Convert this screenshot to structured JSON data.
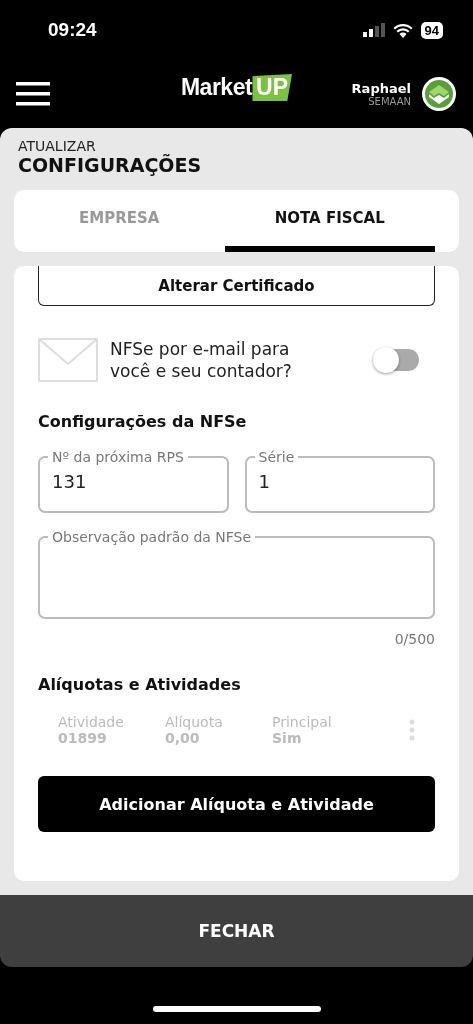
{
  "status_bar": {
    "time": "09:24",
    "battery": "94"
  },
  "header": {
    "logo": {
      "text": "Market",
      "badge": "UP"
    },
    "user": {
      "first_name": "Raphael",
      "last_name": "SEMAAN"
    }
  },
  "page": {
    "subtitle": "ATUALIZAR",
    "title": "CONFIGURAÇÕES"
  },
  "tabs": [
    {
      "label": "EMPRESA",
      "selected": false
    },
    {
      "label": "NOTA FISCAL",
      "selected": true
    }
  ],
  "certificate_button": "Alterar Certificado",
  "email_option": {
    "label": "NFSe por e-mail para você e seu contador?",
    "on": false
  },
  "nfse_section": {
    "heading": "Configurações da NFSe",
    "fields": [
      {
        "label": "Nº da próxima RPS",
        "value": "131"
      },
      {
        "label": "Série",
        "value": "1"
      }
    ],
    "notes": {
      "label": "Observação padrão da NFSe",
      "counter": "0/500"
    }
  },
  "activities_section": {
    "heading": "Alíquotas e Atividades",
    "rows": [
      {
        "cells": [
          {
            "label": "Atividade",
            "value": "01899"
          },
          {
            "label": "Alíquota",
            "value": "0,00"
          },
          {
            "label": "Principal",
            "value": "Sim"
          }
        ]
      }
    ],
    "add_button": "Adicionar Alíquota e Atividade"
  },
  "close_button": "FECHAR"
}
